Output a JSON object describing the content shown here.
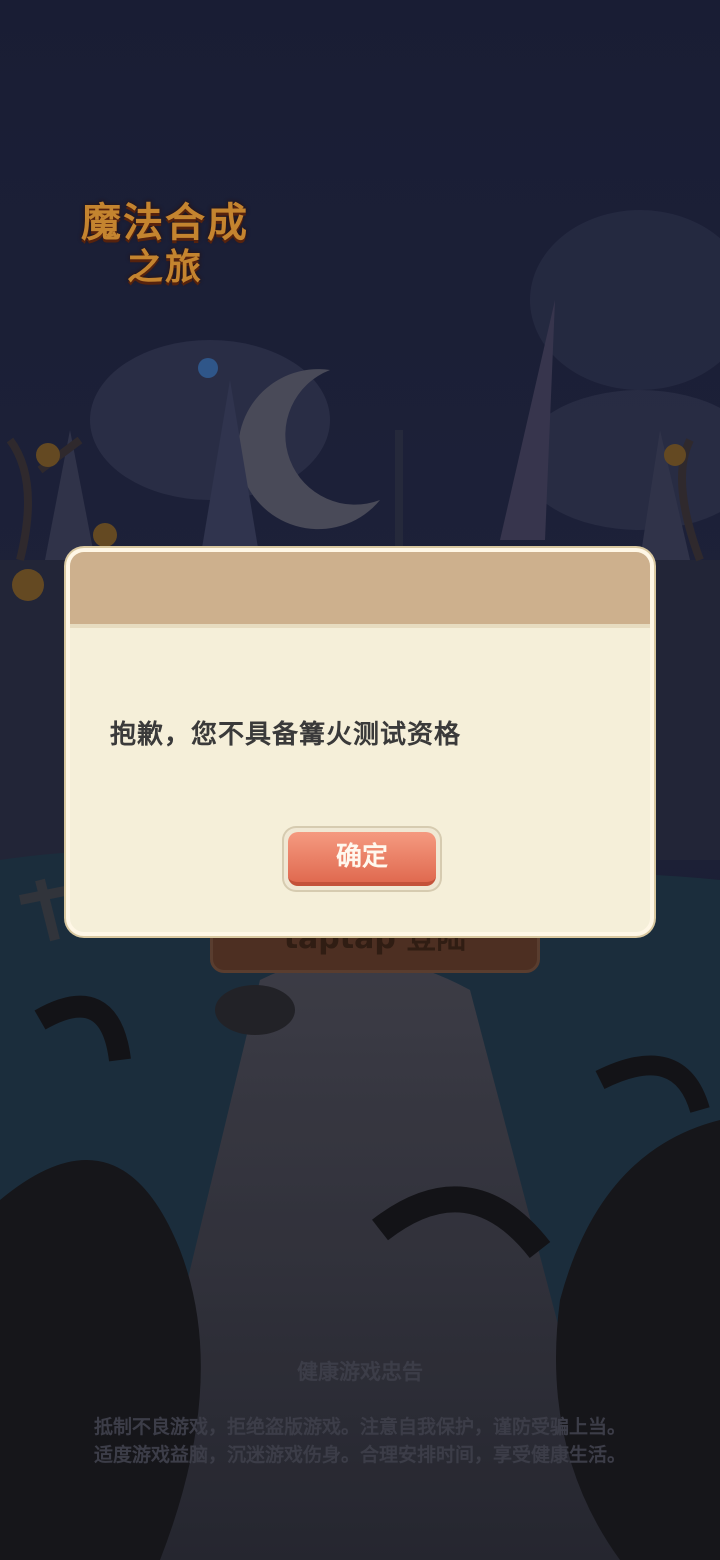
{
  "game": {
    "logo_line1": "魔法合成",
    "logo_line2": "之旅",
    "login_button_label": "taptap 登陆"
  },
  "health_advice": {
    "title": "健康游戏忠告",
    "line1": "抵制不良游戏，拒绝盗版游戏。注意自我保护，谨防受骗上当。",
    "line2": "适度游戏益脑，沉迷游戏伤身。合理安排时间，享受健康生活。"
  },
  "dialog": {
    "message": "抱歉，您不具备篝火测试资格",
    "confirm_label": "确定"
  },
  "colors": {
    "dialog_body": "#f5efd9",
    "dialog_header": "#cdb08d",
    "confirm_button": "#e97a60"
  }
}
